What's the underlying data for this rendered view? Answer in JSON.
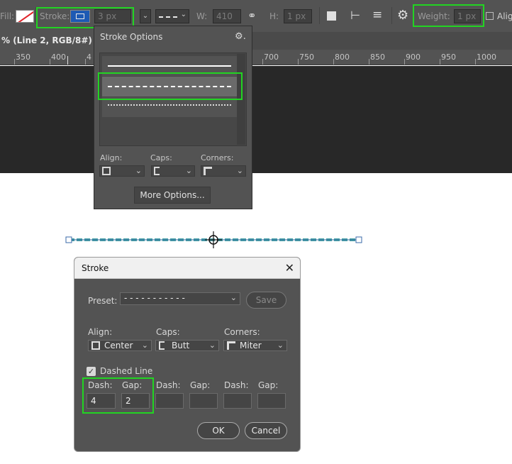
{
  "optionsbar": {
    "fill_label": "Fill:",
    "stroke_label": "Stroke:",
    "stroke_size": "3 px",
    "w_label": "W:",
    "w_value": "410 p",
    "h_label": "H:",
    "h_value": "1 px",
    "weight_label": "Weight:",
    "weight_value": "1 px",
    "align_label": "Alig"
  },
  "document": {
    "tab_title": "% (Line 2, RGB/8#) *",
    "ruler_numbers": [
      "350",
      "400",
      "4",
      "700",
      "750",
      "800",
      "850",
      "900",
      "950",
      "1000"
    ]
  },
  "stroke_options_popup": {
    "title": "Stroke Options",
    "presets": [
      "solid",
      "dashed",
      "dotted"
    ],
    "selected_preset": "dashed",
    "align_label": "Align:",
    "caps_label": "Caps:",
    "corners_label": "Corners:",
    "more_options_label": "More Options..."
  },
  "stroke_dialog": {
    "title": "Stroke",
    "preset_label": "Preset:",
    "preset_value": "- - - - - - - - - - -",
    "save_label": "Save",
    "align_label": "Align:",
    "align_value": "Center",
    "caps_label": "Caps:",
    "caps_value": "Butt",
    "corners_label": "Corners:",
    "corners_value": "Miter",
    "dashed_line_label": "Dashed Line",
    "dashed_checked": true,
    "dash_label": "Dash:",
    "gap_label": "Gap:",
    "dash1": "4",
    "gap1": "2",
    "dash2": "",
    "gap2": "",
    "dash3": "",
    "gap3": "",
    "ok_label": "OK",
    "cancel_label": "Cancel"
  },
  "colors": {
    "highlight": "#22d422",
    "line_stroke": "#4aa0a8",
    "ui_bg": "#535353"
  }
}
